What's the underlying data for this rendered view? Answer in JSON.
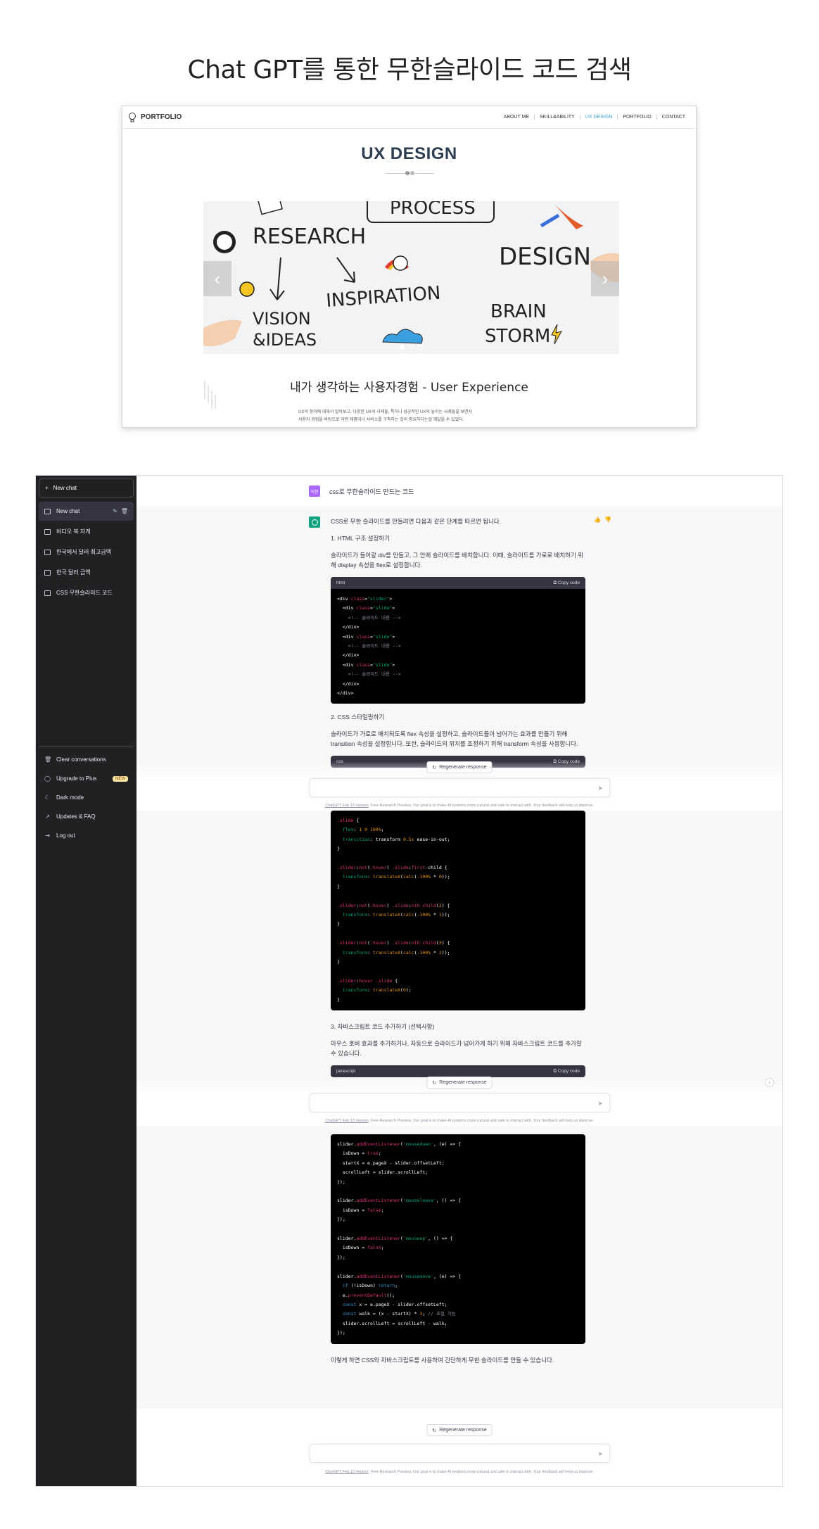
{
  "page": {
    "title": "Chat GPT를 통한 무한슬라이드 코드 검색"
  },
  "portfolio": {
    "logo": "PORTFOLIO",
    "nav": [
      "ABOUT ME",
      "SKILL&ABILITY",
      "UX DESIGN",
      "PORTFOLIO",
      "CONTACT"
    ],
    "active_nav": "UX DESIGN",
    "heading": "UX DESIGN",
    "slide_words": [
      "PROCESS",
      "RESEARCH",
      "DESIGN",
      "INSPIRATION",
      "VISION",
      "&IDEAS",
      "BRAIN",
      "STORM"
    ],
    "subtitle": "내가 생각하는 사용자경험 - User Experience",
    "desc_line1": "UX의 정의에 대해서 알아보고, 다양한 UX의 사례들, 특히나 성공적인 UX의 높이는 사례들을 보면서",
    "desc_line2": "사용자 경험을 바탕으로 어떤 제품이나 서비스를 구축하는 것이 중요하다는걸 깨달을 수 있었다."
  },
  "sidebar": {
    "new_chat_button": "New chat",
    "chats": [
      "New chat",
      "비디오 북 자게",
      "한국에서 달러 최고금액",
      "한국 달러 금액",
      "CSS 무한슬라이드 코드"
    ],
    "bottom": {
      "clear": "Clear conversations",
      "upgrade": "Upgrade to Plus",
      "upgrade_badge": "NEW",
      "dark": "Dark mode",
      "updates": "Updates & FAQ",
      "logout": "Log out"
    }
  },
  "chat": {
    "user_avatar": "이현",
    "user_message": "css로 무한슬라이드 만드는 코드",
    "intro": "CSS로 무한 슬라이드를 만들려면 다음과 같은 단계를 따르면 됩니다.",
    "step1_title": "1.  HTML 구조 설정하기",
    "step1_body": "슬라이드가 들어갈 div를 만들고, 그 안에 슬라이드를 배치합니다. 이때, 슬라이드를 가로로 배치하기 위해 display 속성을 flex로 설정합니다.",
    "code_html_lang": "html",
    "copy_label": "Copy code",
    "step2_title": "2.  CSS 스타일링하기",
    "step2_body": "슬라이드가 가로로 배치되도록 flex 속성을 설정하고, 슬라이드들이 넘어가는 효과를 만들기 위해 transition 속성을 설정합니다. 또한, 슬라이드의 위치를 조정하기 위해 transform 속성을 사용합니다.",
    "code_css_lang": "css",
    "step3_title": "3.  자바스크립트 코드 추가하기 (선택사항)",
    "step3_body": "마우스 호버 효과를 추가하거나, 자동으로 슬라이드가 넘어가게 하기 위해 자바스크립트 코드를 추가할 수 있습니다.",
    "code_js_lang": "javascript",
    "outro": "이렇게 하면 CSS와 자바스크립트를 사용하여 간단하게 무한 슬라이드를 만들 수 있습니다.",
    "regenerate": "Regenerate response",
    "footnote_link": "ChatGPT Feb 13 Version",
    "footnote_text": ". Free Research Preview. Our goal is to make AI systems more natural and safe to interact with. Your feedback will help us improve."
  }
}
